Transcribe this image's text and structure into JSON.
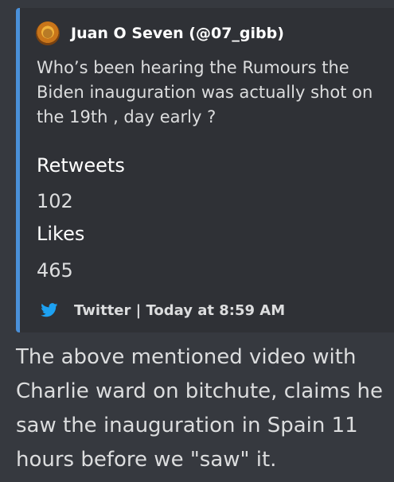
{
  "embed": {
    "author": {
      "name": "Juan O Seven (@07_gibb)",
      "avatar_icon": "lion-avatar-icon"
    },
    "description": "Who’s been hearing the Rumours the Biden inauguration was actually shot on the 19th , day early ?",
    "fields": [
      {
        "name": "Retweets",
        "value": "102"
      },
      {
        "name": "Likes",
        "value": "465"
      }
    ],
    "footer": {
      "icon": "twitter-bird-icon",
      "text": "Twitter | Today at 8:59 AM"
    },
    "accent_color": "#4a90d9"
  },
  "message": {
    "text": "The above mentioned video with Charlie ward on bitchute, claims he saw the inauguration in Spain 11 hours before we \"saw\" it."
  }
}
